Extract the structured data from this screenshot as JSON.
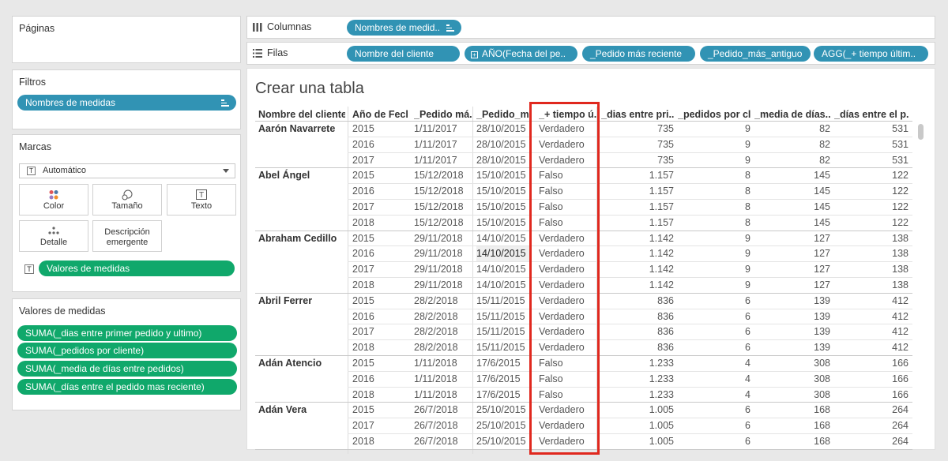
{
  "pages_panel": {
    "title": "Páginas"
  },
  "filters_panel": {
    "title": "Filtros",
    "pill": "Nombres de medidas"
  },
  "marks_panel": {
    "title": "Marcas",
    "type_select": "Automático",
    "buttons": {
      "color": "Color",
      "size": "Tamaño",
      "text": "Texto",
      "detail": "Detalle",
      "tooltip_line1": "Descripción",
      "tooltip_line2": "emergente"
    },
    "text_pill": "Valores de medidas"
  },
  "measure_values_panel": {
    "title": "Valores de medidas",
    "pills": [
      "SUMA(_dias entre primer pedido y ultimo)",
      "SUMA(_pedidos por cliente)",
      "SUMA(_media de días entre pedidos)",
      "SUMA(_días entre el pedido mas reciente)"
    ]
  },
  "columns_shelf": {
    "label": "Columnas",
    "pills": [
      "Nombres de medid.."
    ]
  },
  "rows_shelf": {
    "label": "Filas",
    "pills": [
      "Nombre del cliente",
      "AÑO(Fecha del pe..",
      "_Pedido más reciente",
      "_Pedido_más_antiguo",
      "AGG(_+ tiempo últim.."
    ]
  },
  "view": {
    "title": "Crear una tabla",
    "headers": [
      "Nombre del cliente",
      "Año de Fech..",
      "_Pedido má..",
      "_Pedido_m..",
      "_+ tiempo ú..",
      "_dias entre pri..",
      "_pedidos por cl..",
      "_media de días..",
      "_días entre el p.."
    ],
    "groups": [
      {
        "name": "Aarón Navarrete",
        "rows": [
          [
            "2015",
            "1/11/2017",
            "28/10/2015",
            "Verdadero",
            "735",
            "9",
            "82",
            "531"
          ],
          [
            "2016",
            "1/11/2017",
            "28/10/2015",
            "Verdadero",
            "735",
            "9",
            "82",
            "531"
          ],
          [
            "2017",
            "1/11/2017",
            "28/10/2015",
            "Verdadero",
            "735",
            "9",
            "82",
            "531"
          ]
        ]
      },
      {
        "name": "Abel Ángel",
        "rows": [
          [
            "2015",
            "15/12/2018",
            "15/10/2015",
            "Falso",
            "1.157",
            "8",
            "145",
            "122"
          ],
          [
            "2016",
            "15/12/2018",
            "15/10/2015",
            "Falso",
            "1.157",
            "8",
            "145",
            "122"
          ],
          [
            "2017",
            "15/12/2018",
            "15/10/2015",
            "Falso",
            "1.157",
            "8",
            "145",
            "122"
          ],
          [
            "2018",
            "15/12/2018",
            "15/10/2015",
            "Falso",
            "1.157",
            "8",
            "145",
            "122"
          ]
        ]
      },
      {
        "name": "Abraham Cedillo",
        "rows": [
          [
            "2015",
            "29/11/2018",
            "14/10/2015",
            "Verdadero",
            "1.142",
            "9",
            "127",
            "138"
          ],
          [
            "2016",
            "29/11/2018",
            "14/10/2015",
            "Verdadero",
            "1.142",
            "9",
            "127",
            "138"
          ],
          [
            "2017",
            "29/11/2018",
            "14/10/2015",
            "Verdadero",
            "1.142",
            "9",
            "127",
            "138"
          ],
          [
            "2018",
            "29/11/2018",
            "14/10/2015",
            "Verdadero",
            "1.142",
            "9",
            "127",
            "138"
          ]
        ]
      },
      {
        "name": "Abril Ferrer",
        "rows": [
          [
            "2015",
            "28/2/2018",
            "15/11/2015",
            "Verdadero",
            "836",
            "6",
            "139",
            "412"
          ],
          [
            "2016",
            "28/2/2018",
            "15/11/2015",
            "Verdadero",
            "836",
            "6",
            "139",
            "412"
          ],
          [
            "2017",
            "28/2/2018",
            "15/11/2015",
            "Verdadero",
            "836",
            "6",
            "139",
            "412"
          ],
          [
            "2018",
            "28/2/2018",
            "15/11/2015",
            "Verdadero",
            "836",
            "6",
            "139",
            "412"
          ]
        ]
      },
      {
        "name": "Adán Atencio",
        "rows": [
          [
            "2015",
            "1/11/2018",
            "17/6/2015",
            "Falso",
            "1.233",
            "4",
            "308",
            "166"
          ],
          [
            "2016",
            "1/11/2018",
            "17/6/2015",
            "Falso",
            "1.233",
            "4",
            "308",
            "166"
          ],
          [
            "2018",
            "1/11/2018",
            "17/6/2015",
            "Falso",
            "1.233",
            "4",
            "308",
            "166"
          ]
        ]
      },
      {
        "name": "Adán Vera",
        "rows": [
          [
            "2015",
            "26/7/2018",
            "25/10/2015",
            "Verdadero",
            "1.005",
            "6",
            "168",
            "264"
          ],
          [
            "2017",
            "26/7/2018",
            "25/10/2015",
            "Verdadero",
            "1.005",
            "6",
            "168",
            "264"
          ],
          [
            "2018",
            "26/7/2018",
            "25/10/2015",
            "Verdadero",
            "1.005",
            "6",
            "168",
            "264"
          ]
        ]
      }
    ]
  },
  "colors": {
    "teal_pill": "#3193b4",
    "green_pill": "#10a86b",
    "highlight_box": "#e0281e"
  }
}
